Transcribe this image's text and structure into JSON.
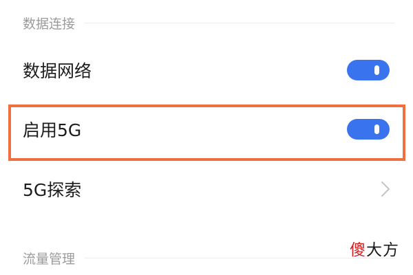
{
  "sections": {
    "data_connection": {
      "title": "数据连接"
    },
    "traffic_management": {
      "title": "流量管理"
    }
  },
  "rows": {
    "mobile_data": {
      "label": "数据网络",
      "toggle_on": true
    },
    "enable_5g": {
      "label": "启用5G",
      "toggle_on": true,
      "highlighted": true
    },
    "explore_5g": {
      "label": "5G探索",
      "icon": "chevron-right-icon"
    }
  },
  "colors": {
    "toggle_on": "#3a73ee",
    "highlight_border": "#ef6f3e",
    "section_title": "#9b9b9b",
    "watermark_accent": "#d21e1e"
  },
  "watermark": {
    "first": "傻",
    "rest": "大方"
  }
}
